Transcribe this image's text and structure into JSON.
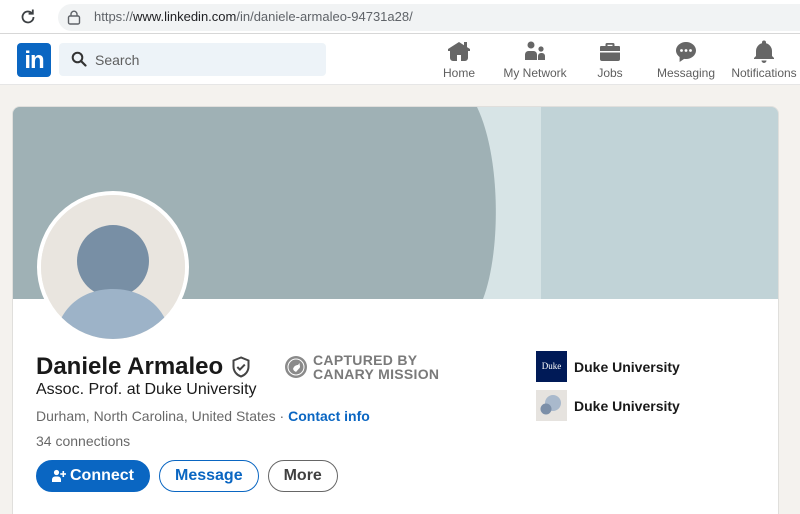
{
  "browser": {
    "url_prefix": "https://",
    "url_host": "www.linkedin.com",
    "url_path": "/in/daniele-armaleo-94731a28/"
  },
  "nav": {
    "logo": "in",
    "search_placeholder": "Search",
    "items": [
      {
        "label": "Home",
        "icon": "home-icon"
      },
      {
        "label": "My Network",
        "icon": "my-network-icon"
      },
      {
        "label": "Jobs",
        "icon": "jobs-icon"
      },
      {
        "label": "Messaging",
        "icon": "messaging-icon"
      },
      {
        "label": "Notifications",
        "icon": "bell-icon"
      }
    ]
  },
  "profile": {
    "name": "Daniele Armaleo",
    "headline": "Assoc. Prof. at Duke University",
    "location": "Durham, North Carolina, United States",
    "separator": " · ",
    "contact_info": "Contact info",
    "connections": "34 connections",
    "captured_line1": "CAPTURED BY",
    "captured_line2": "CANARY MISSION",
    "education": [
      {
        "name": "Duke University",
        "logo_text": "Duke"
      },
      {
        "name": "Duke University"
      }
    ],
    "actions": {
      "connect": "Connect",
      "message": "Message",
      "more": "More"
    }
  },
  "colors": {
    "brand": "#0a66c2",
    "cover_left": "#9fb1b5",
    "cover_right": "#c1d3d7",
    "duke_navy": "#001a57"
  }
}
